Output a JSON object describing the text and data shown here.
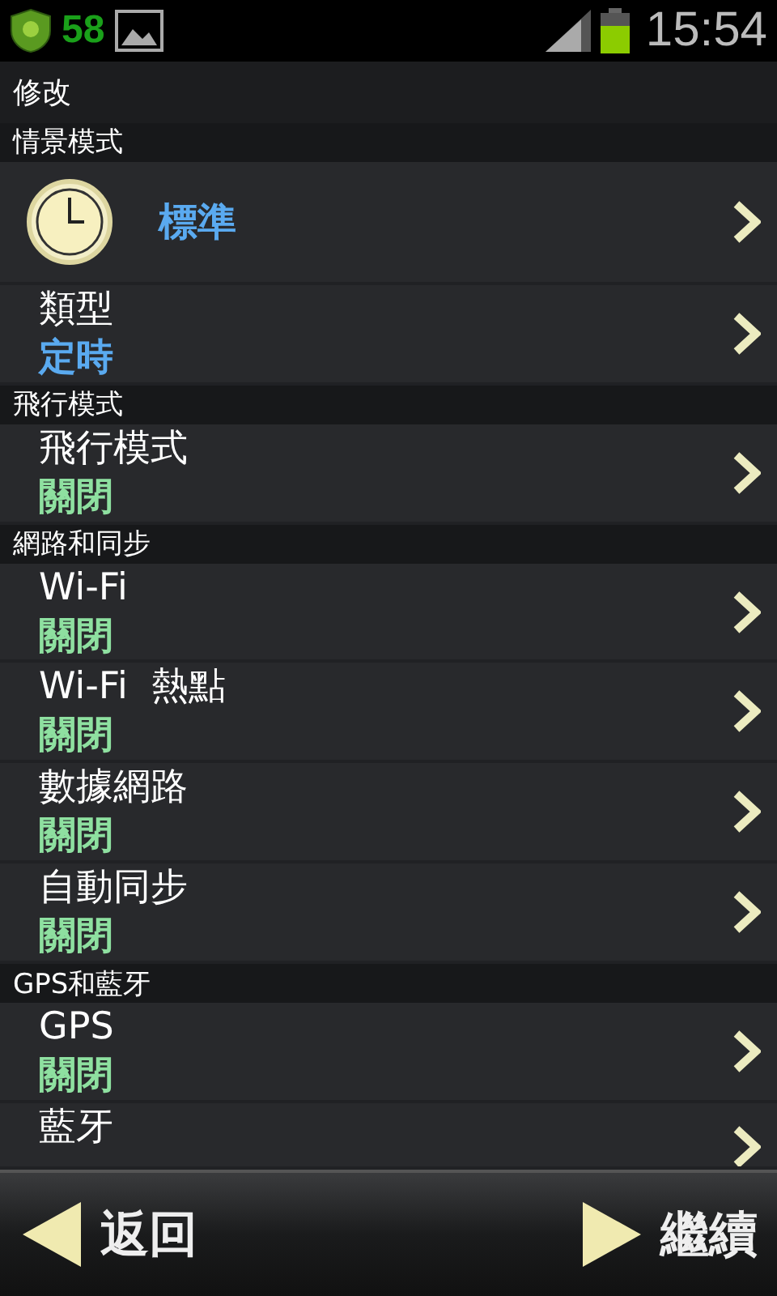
{
  "status_bar": {
    "badge_count": "58",
    "time": "15:54"
  },
  "title": "修改",
  "sections": [
    {
      "header": "情景模式",
      "rows": [
        {
          "kind": "profile",
          "title": "標準"
        },
        {
          "kind": "setting",
          "title": "類型",
          "value": "定時",
          "color": "#5aaaf0"
        }
      ]
    },
    {
      "header": "飛行模式",
      "rows": [
        {
          "kind": "setting",
          "title": "飛行模式",
          "value": "關閉",
          "color": "#8ee0a0"
        }
      ]
    },
    {
      "header": "網路和同步",
      "rows": [
        {
          "kind": "setting",
          "title": "Wi-Fi",
          "value": "關閉",
          "color": "#8ee0a0"
        },
        {
          "kind": "setting",
          "title": "Wi-Fi  熱點",
          "value": "關閉",
          "color": "#8ee0a0"
        },
        {
          "kind": "setting",
          "title": "數據網路",
          "value": "關閉",
          "color": "#8ee0a0"
        },
        {
          "kind": "setting",
          "title": "自動同步",
          "value": "關閉",
          "color": "#8ee0a0"
        }
      ]
    },
    {
      "header": "GPS和藍牙",
      "rows": [
        {
          "kind": "setting",
          "title": "GPS",
          "value": "關閉",
          "color": "#8ee0a0"
        },
        {
          "kind": "partial",
          "title": "藍牙"
        }
      ]
    }
  ],
  "bottom_bar": {
    "back": "返回",
    "next": "繼續"
  }
}
